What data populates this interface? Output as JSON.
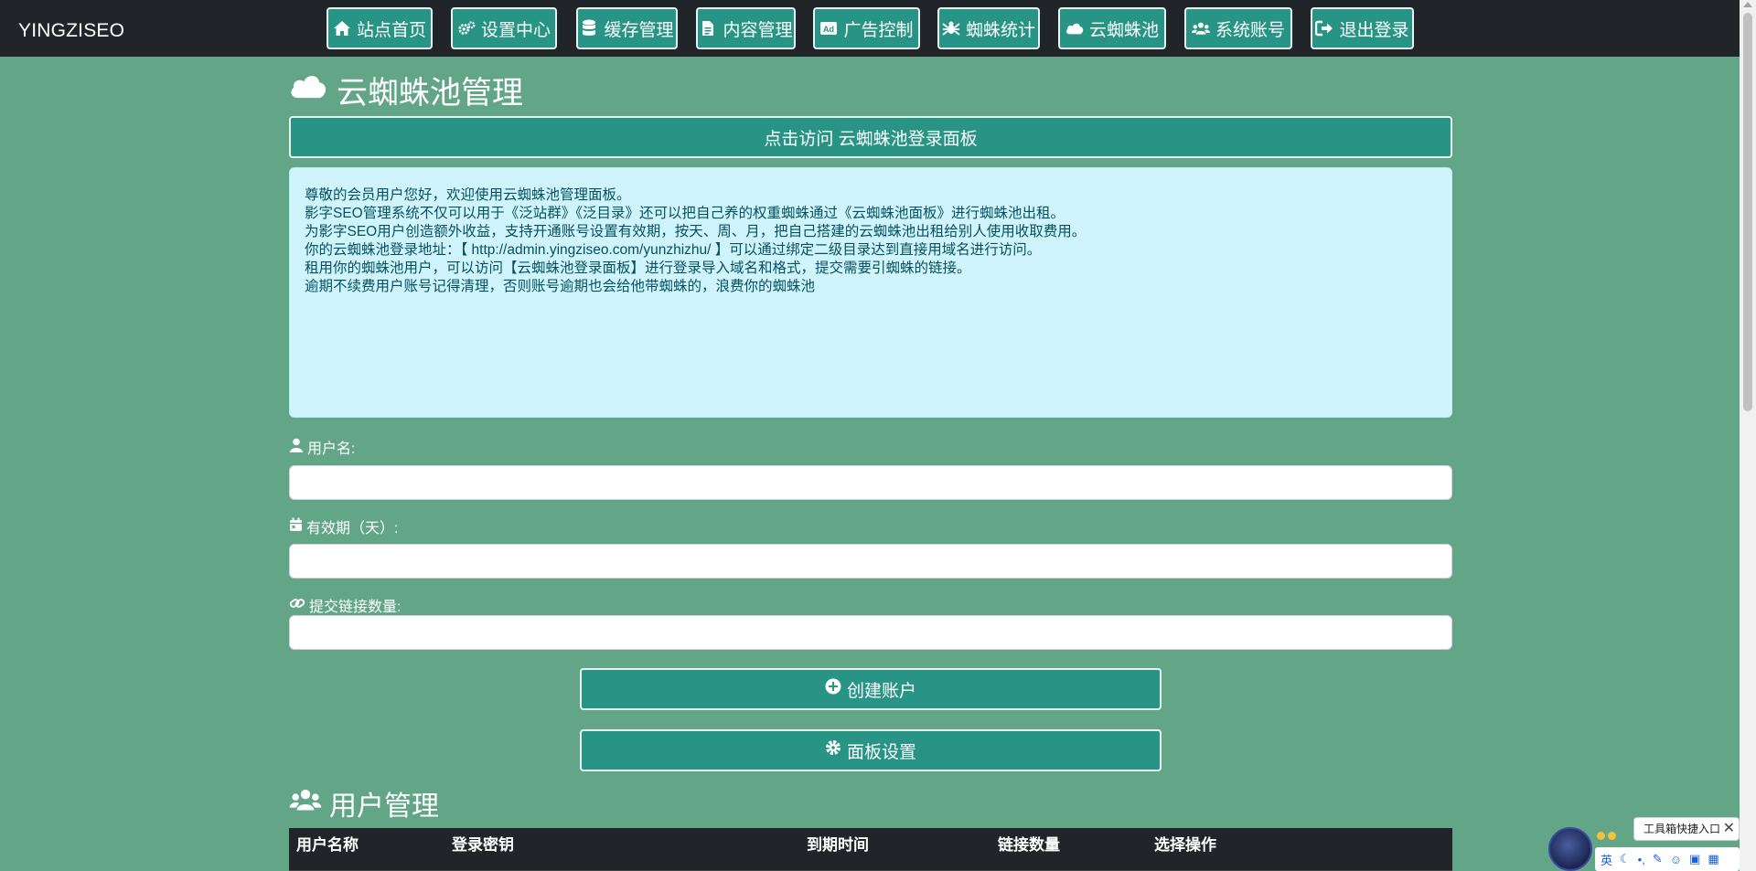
{
  "navbar": {
    "brand": "YINGZISEO",
    "items": [
      {
        "label": "站点首页",
        "icon": "home-icon"
      },
      {
        "label": "设置中心",
        "icon": "gears-icon"
      },
      {
        "label": "缓存管理",
        "icon": "database-icon"
      },
      {
        "label": "内容管理",
        "icon": "file-icon"
      },
      {
        "label": "广告控制",
        "icon": "ad-icon"
      },
      {
        "label": "蜘蛛统计",
        "icon": "spider-icon"
      },
      {
        "label": "云蜘蛛池",
        "icon": "cloud-icon"
      },
      {
        "label": "系统账号",
        "icon": "users-icon"
      },
      {
        "label": "退出登录",
        "icon": "logout-icon"
      }
    ]
  },
  "main": {
    "title": "云蜘蛛池管理",
    "visit_button": "点击访问 云蜘蛛池登录面板",
    "info": [
      "尊敬的会员用户您好，欢迎使用云蜘蛛池管理面板。",
      "影字SEO管理系统不仅可以用于《泛站群》《泛目录》还可以把自己养的权重蜘蛛通过《云蜘蛛池面板》进行蜘蛛池出租。",
      "为影字SEO用户创造额外收益，支持开通账号设置有效期，按天、周、月，把自己搭建的云蜘蛛池出租给别人使用收取费用。",
      "你的云蜘蛛池登录地址：【 http://admin.yingziseo.com/yunzhizhu/ 】可以通过绑定二级目录达到直接用域名进行访问。",
      "租用你的蜘蛛池用户，可以访问【云蜘蛛池登录面板】进行登录导入域名和格式，提交需要引蜘蛛的链接。",
      "逾期不续费用户账号记得清理，否则账号逾期也会给他带蜘蛛的，浪费你的蜘蛛池"
    ],
    "form": {
      "username_label": "用户名:",
      "username_value": "",
      "validity_label": "有效期（天）:",
      "validity_value": "",
      "links_label": "提交链接数量:",
      "links_value": ""
    },
    "create_button": "创建账户",
    "settings_button": "面板设置"
  },
  "users": {
    "title": "用户管理",
    "columns": [
      "用户名称",
      "登录密钥",
      "到期时间",
      "链接数量",
      "选择操作"
    ]
  },
  "widget": {
    "tip": "工具箱快捷入口",
    "close": "✕",
    "lang": "英"
  },
  "colors": {
    "page_bg": "#62a587",
    "navbar_bg": "#212529",
    "button_bg": "#279485",
    "info_bg": "#cff4fc",
    "info_text": "#055160"
  }
}
